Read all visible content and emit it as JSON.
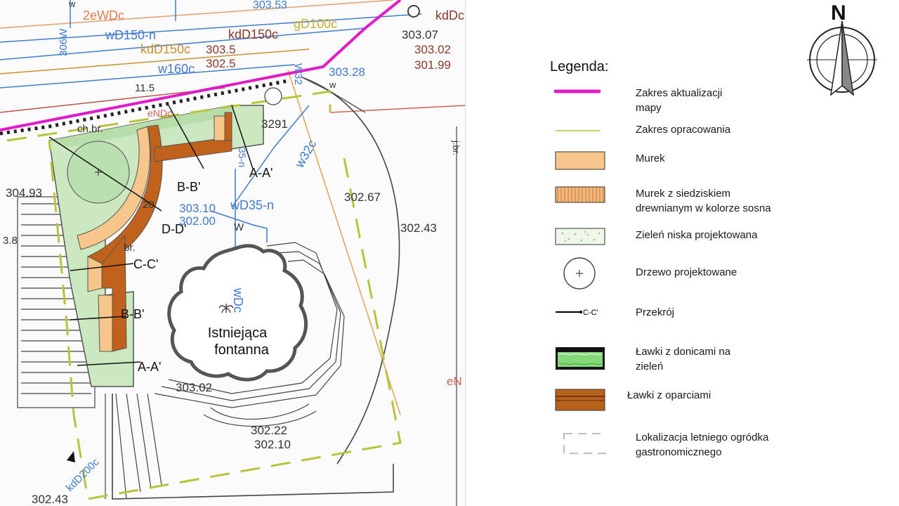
{
  "map": {
    "labels": {
      "sections": {
        "aa_top": "A-A'",
        "aa_bottom": "A-A'",
        "bb_top": "B-B'",
        "bb_mid": "B-B'",
        "cc": "C-C'",
        "dd": "D-D'"
      },
      "fountain": [
        "Istniejąca",
        "fontanna"
      ],
      "dimensions": [
        "11.5",
        "3.8",
        "20"
      ],
      "elevations": [
        "304.93",
        "302.67",
        "302.43",
        "303.02",
        "302.22",
        "302.10",
        "303.10",
        "302.00",
        "303.07",
        "303.02",
        "301.99",
        "303.28",
        "303.5",
        "302.5",
        "302.43"
      ],
      "utilities": [
        "wD150-n",
        "kdD150c",
        "kdD150c",
        "w160c",
        "2eWDc",
        "gD100c",
        "kdDc",
        "wD35-n",
        "w32c",
        "wDc",
        "eNDc",
        "ch.br.",
        "br.",
        "j.br.",
        "W32",
        "306W",
        "3291",
        "kdD200c",
        "35-n",
        "303.53",
        "eN",
        "w",
        "W",
        "w"
      ]
    }
  },
  "legend": {
    "title": "Legenda:",
    "items": [
      {
        "label": "Zakres aktualizacji\nmapy",
        "symbol": "magenta-line",
        "color": "#e11bc9"
      },
      {
        "label": "Zakres opracowania",
        "symbol": "olive-line",
        "color": "#b8c43a"
      },
      {
        "label": "Murek",
        "symbol": "murek-rect",
        "color": "#f7c68b"
      },
      {
        "label": "Murek z siedziskiem\ndrewnianym w kolorze sosna",
        "symbol": "murek-hatched",
        "color": "#f2b06e"
      },
      {
        "label": "Zieleń niska projektowana",
        "symbol": "green-dots-rect",
        "color": "#d8ecd0"
      },
      {
        "label": "Drzewo projektowane",
        "symbol": "tree-circle",
        "color": "#333333"
      },
      {
        "label": "Przekrój",
        "symbol": "section-line",
        "color": "#000000"
      },
      {
        "label": "Ławki z donicami na\nzieleń",
        "symbol": "bench-planter",
        "color": "#7bd46a"
      },
      {
        "label": "Ławki z oparciami",
        "symbol": "bench-backrest",
        "color": "#b8611b"
      },
      {
        "label": "Lokalizacja letniego ogródka\ngastronomicznego",
        "symbol": "dashed-rect",
        "color": "#aaaaaa"
      }
    ],
    "section_symbol_label": "C-C'"
  },
  "north": {
    "label": "N"
  }
}
